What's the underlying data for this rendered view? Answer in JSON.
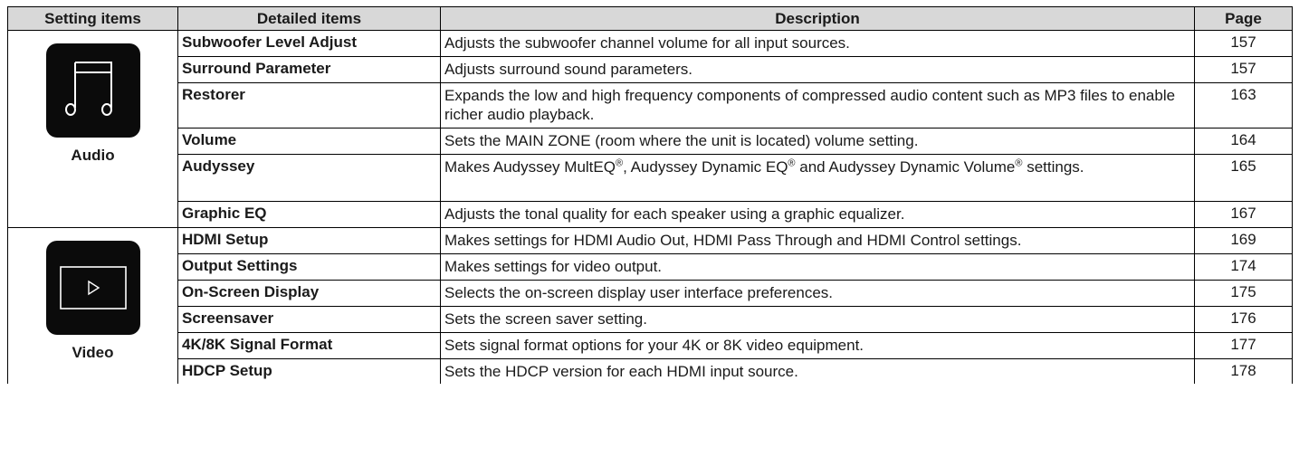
{
  "headers": {
    "setting_items": "Setting items",
    "detailed_items": "Detailed items",
    "description": "Description",
    "page": "Page"
  },
  "groups": [
    {
      "category": "Audio",
      "icon": "music-note-icon",
      "rows": [
        {
          "item": "Subwoofer Level Adjust",
          "desc": "Adjusts the subwoofer channel volume for all input sources.",
          "page": "157"
        },
        {
          "item": "Surround Parameter",
          "desc": "Adjusts surround sound parameters.",
          "page": "157"
        },
        {
          "item": "Restorer",
          "desc": "Expands the low and high frequency components of compressed audio content such as MP3 files to enable richer audio playback.",
          "page": "163"
        },
        {
          "item": "Volume",
          "desc": "Sets the MAIN ZONE (room where the unit is located) volume setting.",
          "page": "164"
        },
        {
          "item": "Audyssey",
          "desc_parts": [
            "Makes Audyssey MultEQ",
            "®",
            ", Audyssey Dynamic EQ",
            "®",
            " and Audyssey Dynamic Volume",
            "®",
            " settings."
          ],
          "page": "165"
        },
        {
          "item": "Graphic EQ",
          "desc": "Adjusts the tonal quality for each speaker using a graphic equalizer.",
          "page": "167"
        }
      ]
    },
    {
      "category": "Video",
      "icon": "play-icon",
      "rows": [
        {
          "item": "HDMI Setup",
          "desc": "Makes settings for HDMI Audio Out, HDMI Pass Through and HDMI Control settings.",
          "page": "169"
        },
        {
          "item": "Output Settings",
          "desc": "Makes settings for video output.",
          "page": "174"
        },
        {
          "item": "On-Screen Display",
          "desc": "Selects the on-screen display user interface preferences.",
          "page": "175"
        },
        {
          "item": "Screensaver",
          "desc": "Sets the screen saver setting.",
          "page": "176"
        },
        {
          "item": "4K/8K Signal Format",
          "desc": "Sets signal format options for your 4K or 8K video equipment.",
          "page": "177"
        },
        {
          "item": "HDCP Setup",
          "desc": "Sets the HDCP version for each HDMI input source.",
          "page": "178"
        }
      ]
    }
  ]
}
